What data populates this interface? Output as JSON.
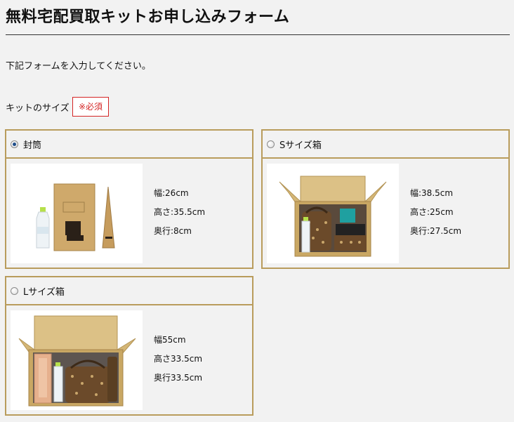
{
  "page": {
    "title": "無料宅配買取キットお申し込みフォーム",
    "intro": "下記フォームを入力してください。"
  },
  "kit_size": {
    "label": "キットのサイズ",
    "required": "※必須",
    "options": [
      {
        "name": "封筒",
        "selected": true,
        "width": "幅:26cm",
        "height": "高さ:35.5cm",
        "depth": "奥行:8cm"
      },
      {
        "name": "Sサイズ箱",
        "selected": false,
        "width": "幅:38.5cm",
        "height": "高さ:25cm",
        "depth": "奥行:27.5cm"
      },
      {
        "name": "Lサイズ箱",
        "selected": false,
        "width": "幅55cm",
        "height": "高さ33.5cm",
        "depth": "奥行33.5cm"
      }
    ]
  },
  "colors": {
    "card_border": "#b99c5c",
    "required_red": "#d42424",
    "page_background": "#f2f2f2"
  }
}
